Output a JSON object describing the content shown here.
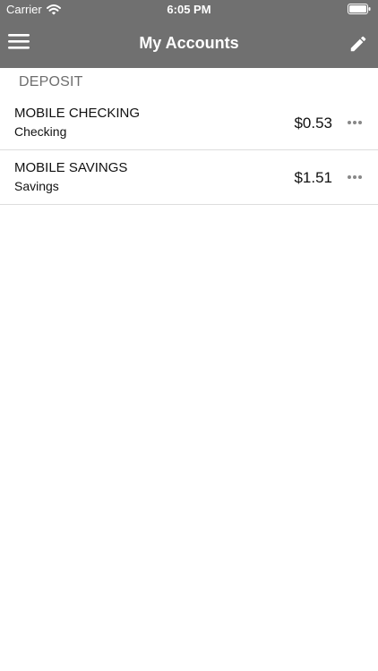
{
  "status_bar": {
    "carrier": "Carrier",
    "time": "6:05 PM"
  },
  "nav": {
    "title": "My Accounts",
    "menu_icon": "hamburger-menu-icon",
    "edit_icon": "pencil-icon"
  },
  "section": {
    "header": "DEPOSIT"
  },
  "accounts": [
    {
      "name": "MOBILE CHECKING",
      "type": "Checking",
      "balance": "$0.53"
    },
    {
      "name": "MOBILE SAVINGS",
      "type": "Savings",
      "balance": "$1.51"
    }
  ],
  "colors": {
    "header_background": "#707070",
    "header_text": "#ffffff",
    "section_text": "#6e6e6e",
    "divider": "#dddddd"
  }
}
